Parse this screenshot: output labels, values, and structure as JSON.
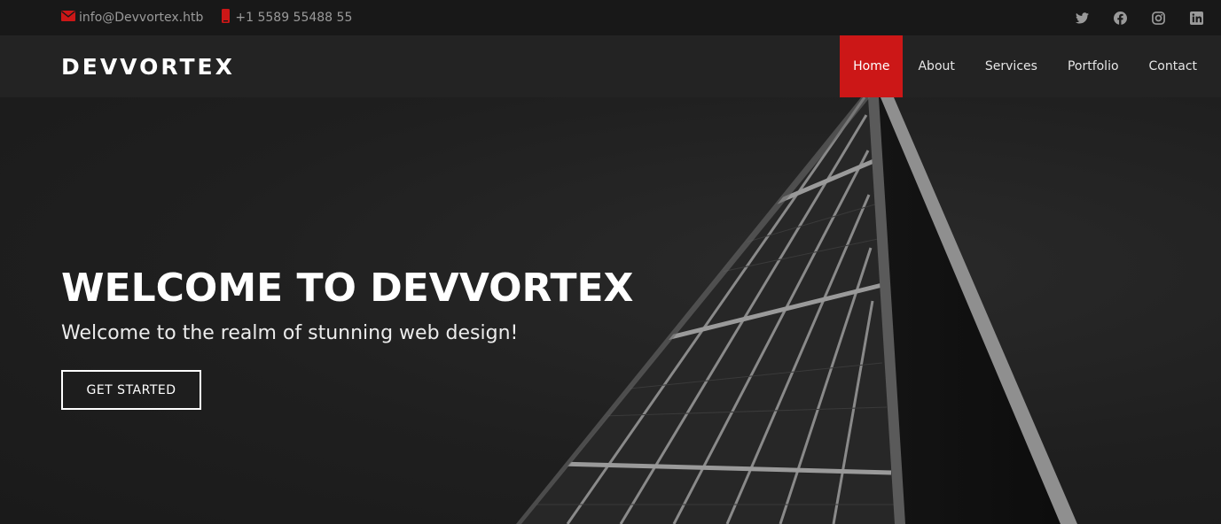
{
  "topbar": {
    "email": "info@Devvortex.htb",
    "phone": "+1 5589 55488 55",
    "social": [
      {
        "icon": "twitter-icon"
      },
      {
        "icon": "facebook-icon"
      },
      {
        "icon": "instagram-icon"
      },
      {
        "icon": "linkedin-icon"
      }
    ]
  },
  "header": {
    "logo": "DEVVORTEX",
    "nav": [
      {
        "label": "Home",
        "active": true
      },
      {
        "label": "About",
        "active": false
      },
      {
        "label": "Services",
        "active": false
      },
      {
        "label": "Portfolio",
        "active": false
      },
      {
        "label": "Contact",
        "active": false
      }
    ]
  },
  "hero": {
    "title": "WELCOME TO DEVVORTEX",
    "subtitle": "Welcome to the realm of stunning web design!",
    "cta_label": "GET STARTED"
  },
  "colors": {
    "accent": "#cc1717",
    "topbar_bg": "#181818",
    "header_bg": "#232323",
    "hero_bg": "#1e1e1e"
  }
}
